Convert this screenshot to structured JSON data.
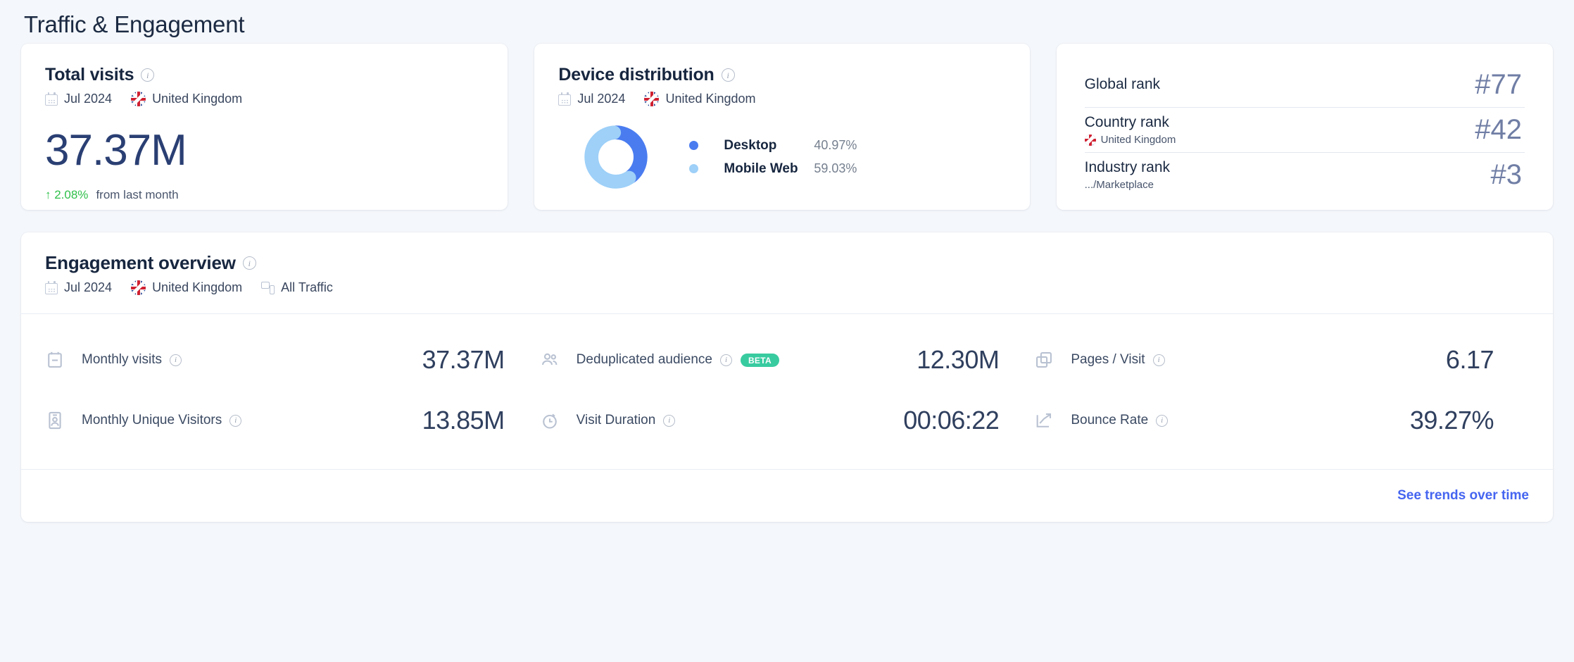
{
  "page": {
    "title": "Traffic & Engagement"
  },
  "colors": {
    "background": "#f4f7fb",
    "card": "#ffffff",
    "text_primary": "#17263f",
    "text_secondary": "#76808f",
    "desktop": "#4a7cf0",
    "mobile_web": "#9ed0f8",
    "positive": "#2fbf4a",
    "beta_badge": "#38cba0",
    "link": "#4565f0",
    "rank_value": "#707ea5"
  },
  "total_visits": {
    "title": "Total visits",
    "info_icon": "info-icon",
    "calendar_icon": "calendar-icon",
    "period": "Jul 2024",
    "flag_icon": "uk-flag-icon",
    "country": "United Kingdom",
    "value": "37.37M",
    "delta": "↑ 2.08%",
    "delta_label": "from last month"
  },
  "device_distribution": {
    "title": "Device distribution",
    "info_icon": "info-icon",
    "calendar_icon": "calendar-icon",
    "period": "Jul 2024",
    "flag_icon": "uk-flag-icon",
    "country": "United Kingdom",
    "legend": [
      {
        "name": "Desktop",
        "pct": "40.97%",
        "color": "#4a7cf0"
      },
      {
        "name": "Mobile Web",
        "pct": "59.03%",
        "color": "#9ed0f8"
      }
    ]
  },
  "ranks": [
    {
      "label": "Global rank",
      "sub": "",
      "has_flag": false,
      "value": "#77"
    },
    {
      "label": "Country rank",
      "sub": "United Kingdom",
      "has_flag": true,
      "value": "#42"
    },
    {
      "label": "Industry rank",
      "sub": ".../Marketplace",
      "has_flag": false,
      "value": "#3"
    }
  ],
  "engagement": {
    "title": "Engagement overview",
    "info_icon": "info-icon",
    "calendar_icon": "calendar-icon",
    "period": "Jul 2024",
    "flag_icon": "uk-flag-icon",
    "country": "United Kingdom",
    "traffic_icon": "devices-icon",
    "traffic_filter": "All Traffic",
    "metrics": [
      {
        "icon": "calendar-clipboard-icon",
        "label": "Monthly visits",
        "value": "37.37M",
        "badge": null
      },
      {
        "icon": "people-icon",
        "label": "Deduplicated audience",
        "value": "12.30M",
        "badge": "BETA"
      },
      {
        "icon": "pages-stack-icon",
        "label": "Pages / Visit",
        "value": "6.17",
        "badge": null
      },
      {
        "icon": "id-badge-icon",
        "label": "Monthly Unique Visitors",
        "value": "13.85M",
        "badge": null
      },
      {
        "icon": "stopwatch-icon",
        "label": "Visit Duration",
        "value": "00:06:22",
        "badge": null
      },
      {
        "icon": "bounce-arrow-icon",
        "label": "Bounce Rate",
        "value": "39.27%",
        "badge": null
      }
    ],
    "footer_link": "See trends over time"
  },
  "chart_data": {
    "type": "pie",
    "title": "Device distribution",
    "subtitle": "Jul 2024 · United Kingdom",
    "categories": [
      "Desktop",
      "Mobile Web"
    ],
    "values": [
      40.97,
      59.03
    ],
    "unit": "%",
    "colors": [
      "#4a7cf0",
      "#9ed0f8"
    ],
    "donut": true,
    "inner_radius_ratio": 0.58,
    "start_angle_deg": -90,
    "direction": "clockwise",
    "legend_position": "right",
    "grid": false
  }
}
